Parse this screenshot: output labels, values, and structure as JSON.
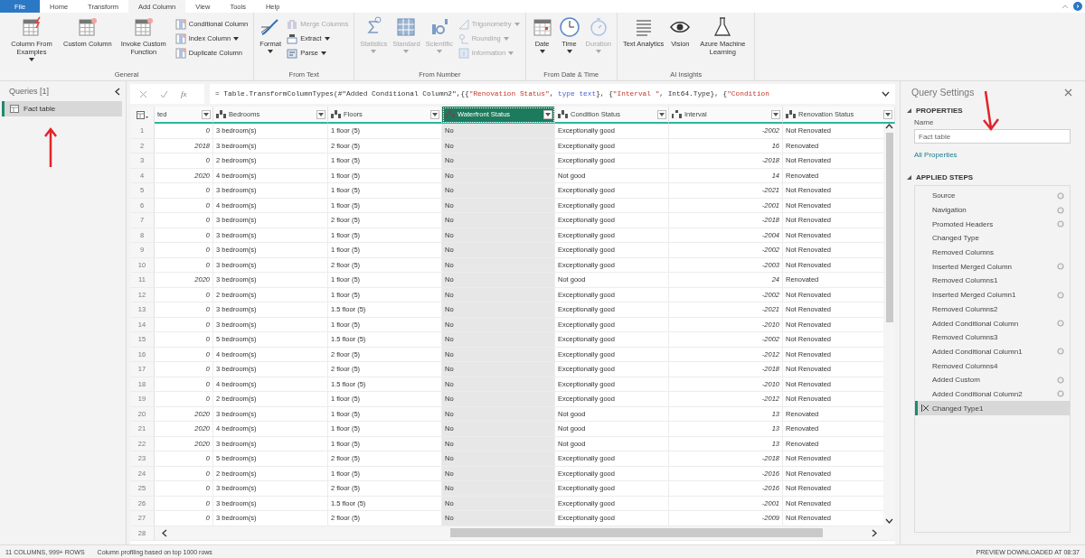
{
  "tabs": [
    {
      "label": "File",
      "kind": "file",
      "selected": false
    },
    {
      "label": "Home",
      "kind": "tab",
      "selected": false
    },
    {
      "label": "Transform",
      "kind": "tab",
      "selected": false
    },
    {
      "label": "Add Column",
      "kind": "tab",
      "selected": true
    },
    {
      "label": "View",
      "kind": "tab",
      "selected": false
    },
    {
      "label": "Tools",
      "kind": "tab",
      "selected": false
    },
    {
      "label": "Help",
      "kind": "tab",
      "selected": false
    }
  ],
  "ribbon": {
    "groups": [
      {
        "label": "General",
        "items": [
          {
            "kind": "large",
            "label": "Column From Examples",
            "dropdown": true,
            "disabled": false
          },
          {
            "kind": "large",
            "label": "Custom Column",
            "dropdown": false,
            "disabled": false
          },
          {
            "kind": "large",
            "label": "Invoke Custom Function",
            "dropdown": false,
            "disabled": false
          },
          {
            "kind": "small",
            "label": "Conditional Column",
            "dropdown": false,
            "disabled": false
          },
          {
            "kind": "small",
            "label": "Index Column",
            "dropdown": true,
            "disabled": false
          },
          {
            "kind": "small",
            "label": "Duplicate Column",
            "dropdown": false,
            "disabled": false
          }
        ]
      },
      {
        "label": "From Text",
        "items": [
          {
            "kind": "large",
            "label": "Format",
            "dropdown": true,
            "disabled": false
          },
          {
            "kind": "small",
            "label": "Merge Columns",
            "dropdown": false,
            "disabled": true
          },
          {
            "kind": "small",
            "label": "Extract",
            "dropdown": true,
            "disabled": false
          },
          {
            "kind": "small",
            "label": "Parse",
            "dropdown": true,
            "disabled": false
          }
        ]
      },
      {
        "label": "From Number",
        "items": [
          {
            "kind": "large",
            "label": "Statistics",
            "dropdown": true,
            "disabled": true
          },
          {
            "kind": "large",
            "label": "Standard",
            "dropdown": true,
            "disabled": true
          },
          {
            "kind": "large",
            "label": "Scientific",
            "dropdown": true,
            "disabled": true
          },
          {
            "kind": "small",
            "label": "Trigonometry",
            "dropdown": true,
            "disabled": true
          },
          {
            "kind": "small",
            "label": "Rounding",
            "dropdown": true,
            "disabled": true
          },
          {
            "kind": "small",
            "label": "Information",
            "dropdown": true,
            "disabled": true
          }
        ]
      },
      {
        "label": "From Date & Time",
        "items": [
          {
            "kind": "large",
            "label": "Date",
            "dropdown": true,
            "disabled": false
          },
          {
            "kind": "large",
            "label": "Time",
            "dropdown": true,
            "disabled": false
          },
          {
            "kind": "large",
            "label": "Duration",
            "dropdown": true,
            "disabled": true
          }
        ]
      },
      {
        "label": "AI Insights",
        "items": [
          {
            "kind": "large",
            "label": "Text Analytics",
            "dropdown": false,
            "disabled": false
          },
          {
            "kind": "large",
            "label": "Vision",
            "dropdown": false,
            "disabled": false
          },
          {
            "kind": "large",
            "label": "Azure Machine Learning",
            "dropdown": false,
            "disabled": false
          }
        ]
      }
    ]
  },
  "queries": {
    "title": "Queries [1]",
    "items": [
      {
        "label": "Fact table",
        "selected": true
      }
    ]
  },
  "formula_bar": {
    "function_label": "fx",
    "segments": [
      {
        "kind": "plain",
        "text": "= Table.TransformColumnTypes(#\"Added Conditional Column2\",{{"
      },
      {
        "kind": "string",
        "text": "\"Renovation Status\""
      },
      {
        "kind": "plain",
        "text": ", "
      },
      {
        "kind": "keyword",
        "text": "type text"
      },
      {
        "kind": "plain",
        "text": "}, {"
      },
      {
        "kind": "string",
        "text": "\"Interval \""
      },
      {
        "kind": "plain",
        "text": ", Int64.Type}, {"
      },
      {
        "kind": "string",
        "text": "\"Condition"
      }
    ]
  },
  "table": {
    "columns": [
      {
        "label": "ted",
        "numeric": true,
        "selected": false
      },
      {
        "label": "Bedrooms",
        "kind": "text",
        "numeric": false,
        "selected": false
      },
      {
        "label": "Floors",
        "kind": "text",
        "numeric": false,
        "selected": false
      },
      {
        "label": "Waterfront Status",
        "kind": "text",
        "numeric": false,
        "selected": true
      },
      {
        "label": "Condition Status",
        "kind": "text",
        "numeric": false,
        "selected": false
      },
      {
        "label": "Interval",
        "kind": "whole",
        "numeric": true,
        "selected": false
      },
      {
        "label": "Renovation Status",
        "kind": "text",
        "numeric": false,
        "selected": false
      }
    ],
    "rows": [
      {
        "number": "1",
        "cells": [
          "0",
          "3 bedroom(s)",
          "1 floor (5)",
          "No",
          "Exceptionally good",
          "-2002",
          "Not Renovated"
        ]
      },
      {
        "number": "2",
        "cells": [
          "2018",
          "3 bedroom(s)",
          "2 floor (5)",
          "No",
          "Exceptionally good",
          "16",
          "Renovated"
        ]
      },
      {
        "number": "3",
        "cells": [
          "0",
          "2 bedroom(s)",
          "1 floor (5)",
          "No",
          "Exceptionally good",
          "-2018",
          "Not Renovated"
        ]
      },
      {
        "number": "4",
        "cells": [
          "2020",
          "4 bedroom(s)",
          "1 floor (5)",
          "No",
          "Not good",
          "14",
          "Renovated"
        ]
      },
      {
        "number": "5",
        "cells": [
          "0",
          "3 bedroom(s)",
          "1 floor (5)",
          "No",
          "Exceptionally good",
          "-2021",
          "Not Renovated"
        ]
      },
      {
        "number": "6",
        "cells": [
          "0",
          "4 bedroom(s)",
          "1 floor (5)",
          "No",
          "Exceptionally good",
          "-2001",
          "Not Renovated"
        ]
      },
      {
        "number": "7",
        "cells": [
          "0",
          "3 bedroom(s)",
          "2 floor (5)",
          "No",
          "Exceptionally good",
          "-2018",
          "Not Renovated"
        ]
      },
      {
        "number": "8",
        "cells": [
          "0",
          "3 bedroom(s)",
          "1 floor (5)",
          "No",
          "Exceptionally good",
          "-2004",
          "Not Renovated"
        ]
      },
      {
        "number": "9",
        "cells": [
          "0",
          "3 bedroom(s)",
          "1 floor (5)",
          "No",
          "Exceptionally good",
          "-2002",
          "Not Renovated"
        ]
      },
      {
        "number": "10",
        "cells": [
          "0",
          "3 bedroom(s)",
          "2 floor (5)",
          "No",
          "Exceptionally good",
          "-2003",
          "Not Renovated"
        ]
      },
      {
        "number": "11",
        "cells": [
          "2020",
          "3 bedroom(s)",
          "1 floor (5)",
          "No",
          "Not good",
          "24",
          "Renovated"
        ]
      },
      {
        "number": "12",
        "cells": [
          "0",
          "2 bedroom(s)",
          "1 floor (5)",
          "No",
          "Exceptionally good",
          "-2002",
          "Not Renovated"
        ]
      },
      {
        "number": "13",
        "cells": [
          "0",
          "3 bedroom(s)",
          "1.5 floor (5)",
          "No",
          "Exceptionally good",
          "-2021",
          "Not Renovated"
        ]
      },
      {
        "number": "14",
        "cells": [
          "0",
          "3 bedroom(s)",
          "1 floor (5)",
          "No",
          "Exceptionally good",
          "-2010",
          "Not Renovated"
        ]
      },
      {
        "number": "15",
        "cells": [
          "0",
          "5 bedroom(s)",
          "1.5 floor (5)",
          "No",
          "Exceptionally good",
          "-2002",
          "Not Renovated"
        ]
      },
      {
        "number": "16",
        "cells": [
          "0",
          "4 bedroom(s)",
          "2 floor (5)",
          "No",
          "Exceptionally good",
          "-2012",
          "Not Renovated"
        ]
      },
      {
        "number": "17",
        "cells": [
          "0",
          "3 bedroom(s)",
          "2 floor (5)",
          "No",
          "Exceptionally good",
          "-2018",
          "Not Renovated"
        ]
      },
      {
        "number": "18",
        "cells": [
          "0",
          "4 bedroom(s)",
          "1.5 floor (5)",
          "No",
          "Exceptionally good",
          "-2010",
          "Not Renovated"
        ]
      },
      {
        "number": "19",
        "cells": [
          "0",
          "2 bedroom(s)",
          "1 floor (5)",
          "No",
          "Exceptionally good",
          "-2012",
          "Not Renovated"
        ]
      },
      {
        "number": "20",
        "cells": [
          "2020",
          "3 bedroom(s)",
          "1 floor (5)",
          "No",
          "Not good",
          "13",
          "Renovated"
        ]
      },
      {
        "number": "21",
        "cells": [
          "2020",
          "4 bedroom(s)",
          "1 floor (5)",
          "No",
          "Not good",
          "13",
          "Renovated"
        ]
      },
      {
        "number": "22",
        "cells": [
          "2020",
          "3 bedroom(s)",
          "1 floor (5)",
          "No",
          "Not good",
          "13",
          "Renovated"
        ]
      },
      {
        "number": "23",
        "cells": [
          "0",
          "5 bedroom(s)",
          "2 floor (5)",
          "No",
          "Exceptionally good",
          "-2018",
          "Not Renovated"
        ]
      },
      {
        "number": "24",
        "cells": [
          "0",
          "2 bedroom(s)",
          "1 floor (5)",
          "No",
          "Exceptionally good",
          "-2016",
          "Not Renovated"
        ]
      },
      {
        "number": "25",
        "cells": [
          "0",
          "3 bedroom(s)",
          "2 floor (5)",
          "No",
          "Exceptionally good",
          "-2016",
          "Not Renovated"
        ]
      },
      {
        "number": "26",
        "cells": [
          "0",
          "3 bedroom(s)",
          "1.5 floor (5)",
          "No",
          "Exceptionally good",
          "-2001",
          "Not Renovated"
        ]
      },
      {
        "number": "27",
        "cells": [
          "0",
          "3 bedroom(s)",
          "2 floor (5)",
          "No",
          "Exceptionally good",
          "-2009",
          "Not Renovated"
        ]
      },
      {
        "number": "28"
      }
    ]
  },
  "query_settings": {
    "title": "Query Settings",
    "properties": {
      "heading": "PROPERTIES",
      "name_label": "Name",
      "name_value": "Fact table",
      "link": "All Properties"
    },
    "applied_steps": {
      "heading": "APPLIED STEPS",
      "steps": [
        {
          "label": "Source",
          "settings": true,
          "selected": false
        },
        {
          "label": "Navigation",
          "settings": true,
          "selected": false
        },
        {
          "label": "Promoted Headers",
          "settings": true,
          "selected": false
        },
        {
          "label": "Changed Type",
          "settings": false,
          "selected": false
        },
        {
          "label": "Removed Columns",
          "settings": false,
          "selected": false
        },
        {
          "label": "Inserted Merged Column",
          "settings": true,
          "selected": false
        },
        {
          "label": "Removed Columns1",
          "settings": false,
          "selected": false
        },
        {
          "label": "Inserted Merged Column1",
          "settings": true,
          "selected": false
        },
        {
          "label": "Removed Columns2",
          "settings": false,
          "selected": false
        },
        {
          "label": "Added Conditional Column",
          "settings": true,
          "selected": false
        },
        {
          "label": "Removed Columns3",
          "settings": false,
          "selected": false
        },
        {
          "label": "Added Conditional Column1",
          "settings": true,
          "selected": false
        },
        {
          "label": "Removed Columns4",
          "settings": false,
          "selected": false
        },
        {
          "label": "Added Custom",
          "settings": true,
          "selected": false
        },
        {
          "label": "Added Conditional Column2",
          "settings": true,
          "selected": false
        },
        {
          "label": "Changed Type1",
          "settings": false,
          "selected": true
        }
      ]
    }
  },
  "status_bar": {
    "left": "11 COLUMNS, 999+ ROWS",
    "middle": "Column profiling based on top 1000 rows",
    "right": "PREVIEW DOWNLOADED AT 08:37"
  }
}
